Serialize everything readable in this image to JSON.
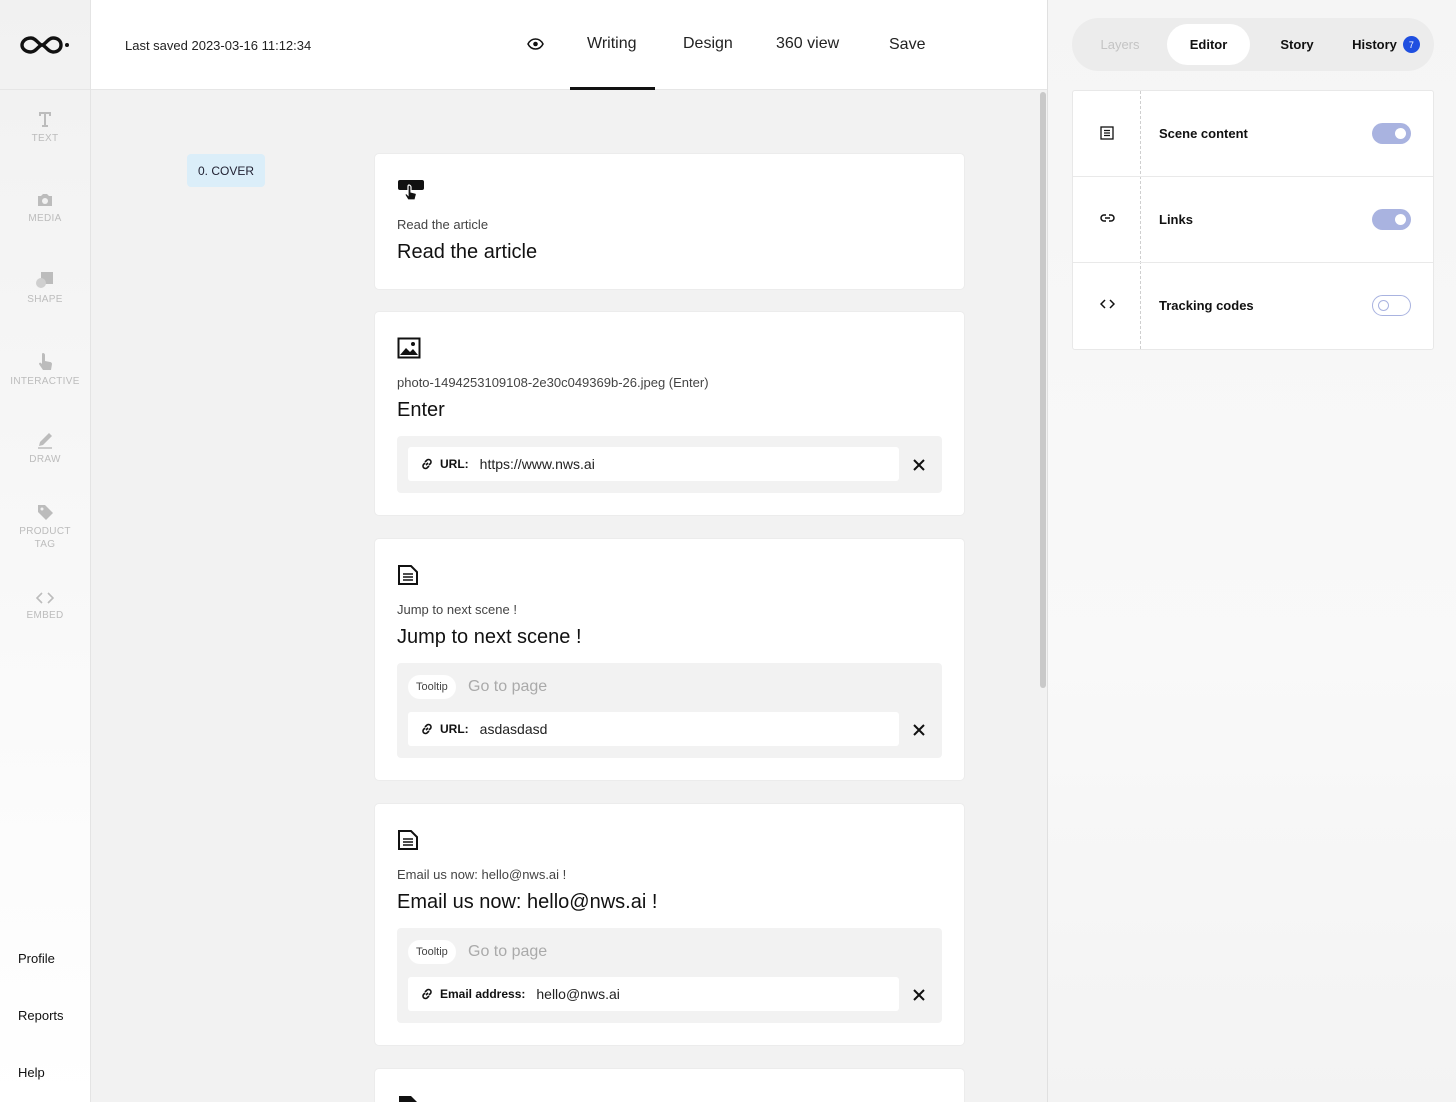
{
  "sidebar": {
    "tools": [
      {
        "label": "TEXT",
        "icon": "text-icon"
      },
      {
        "label": "MEDIA",
        "icon": "camera-icon"
      },
      {
        "label": "SHAPE",
        "icon": "shape-icon"
      },
      {
        "label": "INTERACTIVE",
        "icon": "pointer-icon"
      },
      {
        "label": "DRAW",
        "icon": "pencil-icon"
      },
      {
        "label": "PRODUCT\nTAG",
        "icon": "tag-icon"
      },
      {
        "label": "EMBED",
        "icon": "code-icon"
      }
    ],
    "bottom": [
      "Profile",
      "Reports",
      "Help"
    ]
  },
  "topbar": {
    "last_saved": "Last saved 2023-03-16 11:12:34",
    "tabs": [
      "Writing",
      "Design",
      "360 view"
    ],
    "active_tab": "Writing",
    "save": "Save"
  },
  "main": {
    "scene_chip": "0. COVER",
    "cards": [
      {
        "icon": "touch-icon",
        "sub": "Read the article",
        "title": "Read the article"
      },
      {
        "icon": "image-icon",
        "sub": "photo-1494253109108-2e30c049369b-26.jpeg (Enter)",
        "title": "Enter",
        "field_label": "URL:",
        "field_value": "https://www.nws.ai"
      },
      {
        "icon": "document-icon",
        "sub": "Jump to next scene !",
        "title": "Jump to next scene !",
        "tooltip_label": "Tooltip",
        "tooltip_placeholder": "Go to page",
        "field_label": "URL:",
        "field_value": "asdasdasd"
      },
      {
        "icon": "document-icon",
        "sub": "Email us now: hello@nws.ai !",
        "title": "Email us now: hello@nws.ai !",
        "tooltip_label": "Tooltip",
        "tooltip_placeholder": "Go to page",
        "field_label": "Email address:",
        "field_value": "hello@nws.ai"
      }
    ]
  },
  "right_panel": {
    "tabs": [
      "Layers",
      "Editor",
      "Story",
      "History"
    ],
    "active_tab": "Editor",
    "history_badge": "7",
    "rows": [
      {
        "label": "Scene content",
        "icon": "list-icon",
        "on": true
      },
      {
        "label": "Links",
        "icon": "link-icon",
        "on": true
      },
      {
        "label": "Tracking codes",
        "icon": "code-icon",
        "on": false
      }
    ]
  },
  "colors": {
    "accent": "#1f4fe0",
    "toggle": "#a9b3e0",
    "chip": "#dbeef9"
  }
}
